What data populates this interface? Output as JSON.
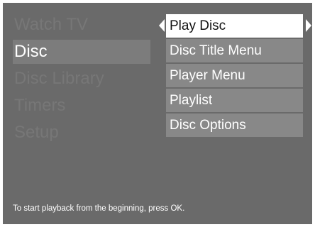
{
  "main_menu": {
    "items": [
      "Watch TV",
      "Disc",
      "Disc Library",
      "Timers",
      "Setup"
    ],
    "selected": "Disc"
  },
  "disc_submenu": {
    "items": [
      "Play Disc",
      "Disc Title Menu",
      "Player Menu",
      "Playlist",
      "Disc Options"
    ],
    "selected": "Play Disc"
  },
  "help": {
    "text": "To start playback from the beginning, press OK."
  },
  "colors": {
    "background": "#6a6a6a",
    "submenu_item": "#888888",
    "selected_item": "#ffffff",
    "active_left": "#7c7c7c",
    "inactive_text": "#777777"
  }
}
